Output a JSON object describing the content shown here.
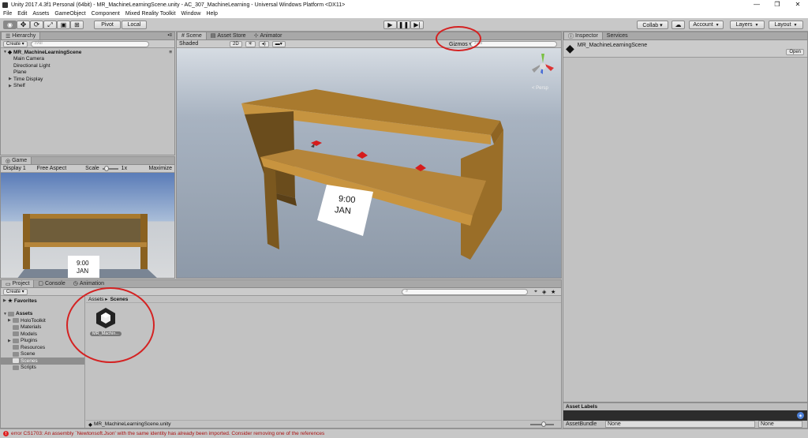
{
  "window": {
    "title": "Unity 2017.4.3f1 Personal (64bit) - MR_MachineLearningScene.unity - AC_307_MachineLearning - Universal Windows Platform <DX11>",
    "minimize": "—",
    "maximize": "❐",
    "close": "✕"
  },
  "menu": [
    "File",
    "Edit",
    "Assets",
    "GameObject",
    "Component",
    "Mixed Reality Toolkit",
    "Window",
    "Help"
  ],
  "toolbar": {
    "pivot": "Pivot",
    "local": "Local",
    "collab": "Collab ▾",
    "account": "Account",
    "layers": "Layers",
    "layout": "Layout"
  },
  "hierarchy": {
    "tab": "Hierarchy",
    "create": "Create ▾",
    "search": "⌕All",
    "scene": "MR_MachineLearningScene",
    "items": [
      "Main Camera",
      "Directional Light",
      "Plane",
      "Time Display",
      "Shelf"
    ]
  },
  "game": {
    "tab": "Game",
    "display": "Display 1",
    "aspect": "Free Aspect",
    "scale": "Scale",
    "scale_value": "1x",
    "maximize": "Maximize",
    "time": "9:00",
    "month": "JAN"
  },
  "scene": {
    "tabs": [
      "Scene",
      "Asset Store",
      "Animator"
    ],
    "shaded": "Shaded",
    "mode2d": "2D",
    "gizmos": "Gizmos ▾",
    "search": "⌕All",
    "persp": "< Persp",
    "time": "9:00",
    "month": "JAN"
  },
  "inspector": {
    "tabs": [
      "Inspector",
      "Services"
    ],
    "name": "MR_MachineLearningScene",
    "open": "Open",
    "asset_labels": "Asset Labels",
    "asset_bundle": "AssetBundle",
    "none1": "None",
    "none2": "None"
  },
  "project": {
    "tabs": [
      "Project",
      "Console",
      "Animation"
    ],
    "create": "Create ▾",
    "favorites": "Favorites",
    "assets": "Assets",
    "folders": [
      "HoloToolkit",
      "Materials",
      "Models",
      "Plugins",
      "Resources",
      "Scene",
      "Scenes",
      "Scripts"
    ],
    "breadcrumb_root": "Assets ▸",
    "breadcrumb_current": "Scenes",
    "file": "MR_Machin...",
    "footer": "MR_MachineLearningScene.unity"
  },
  "status": {
    "error": "error CS1703: An assembly `Newtonsoft.Json' with the same identity has already been imported. Consider removing one of the references"
  },
  "colors": {
    "highlight": "#d42222",
    "shelf": "#a97a2e",
    "panel": "#c2c2c2",
    "selected": "#8e8e8e"
  }
}
